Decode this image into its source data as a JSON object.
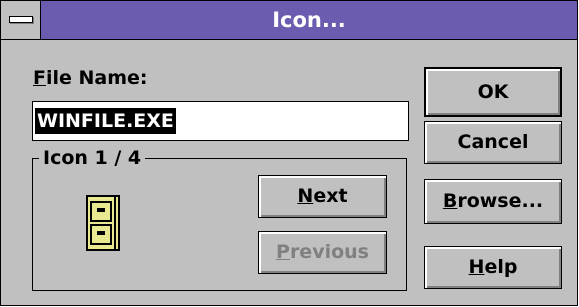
{
  "window": {
    "title": "Icon..."
  },
  "file_name": {
    "label_accel": "F",
    "label_rest": "ile Name:",
    "value": "WINFILE.EXE"
  },
  "icon_group": {
    "label": "Icon 1 / 4",
    "icon_name": "file-cabinet-icon"
  },
  "buttons": {
    "ok": "OK",
    "cancel": "Cancel",
    "browse_accel": "B",
    "browse_rest": "rowse...",
    "help_accel": "H",
    "help_rest": "elp",
    "next_accel": "N",
    "next_rest": "ext",
    "previous_accel": "P",
    "previous_rest": "revious"
  },
  "colors": {
    "titlebar": "#6b5cb0",
    "dialog_face": "#c0c0c0",
    "icon_fill": "#e8e890"
  }
}
